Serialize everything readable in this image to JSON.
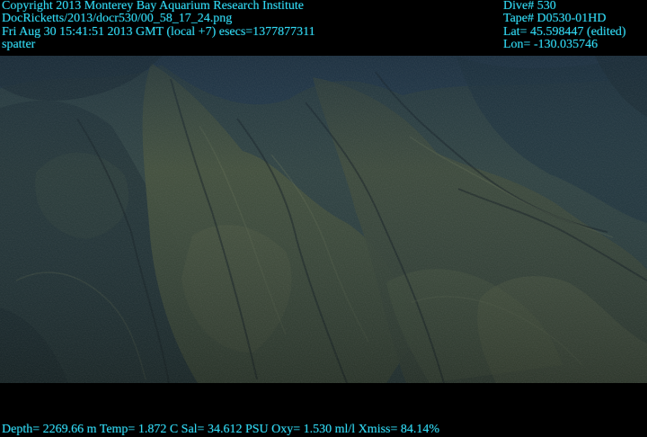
{
  "overlay": {
    "copyright": "Copyright 2013 Monterey Bay Aquarium Research Institute",
    "image_path": "DocRicketts/2013/docr530/00_58_17_24.png",
    "timestamp": "Fri Aug 30 15:41:51 2013 GMT (local +7)  esecs=1377877311",
    "label": "spatter",
    "dive": "Dive# 530",
    "tape": "Tape# D0530-01HD",
    "lat": "Lat= 45.598447 (edited)",
    "lon": "Lon= -130.035746",
    "telemetry": "Depth= 2269.66 m  Temp= 1.872 C  Sal= 34.612 PSU  Oxy= 1.530 ml/l  Xmiss= 84.14%"
  },
  "colors": {
    "overlay_text": "#31d8f2",
    "background": "#000000",
    "water": "#203949",
    "rock": "#485236"
  }
}
